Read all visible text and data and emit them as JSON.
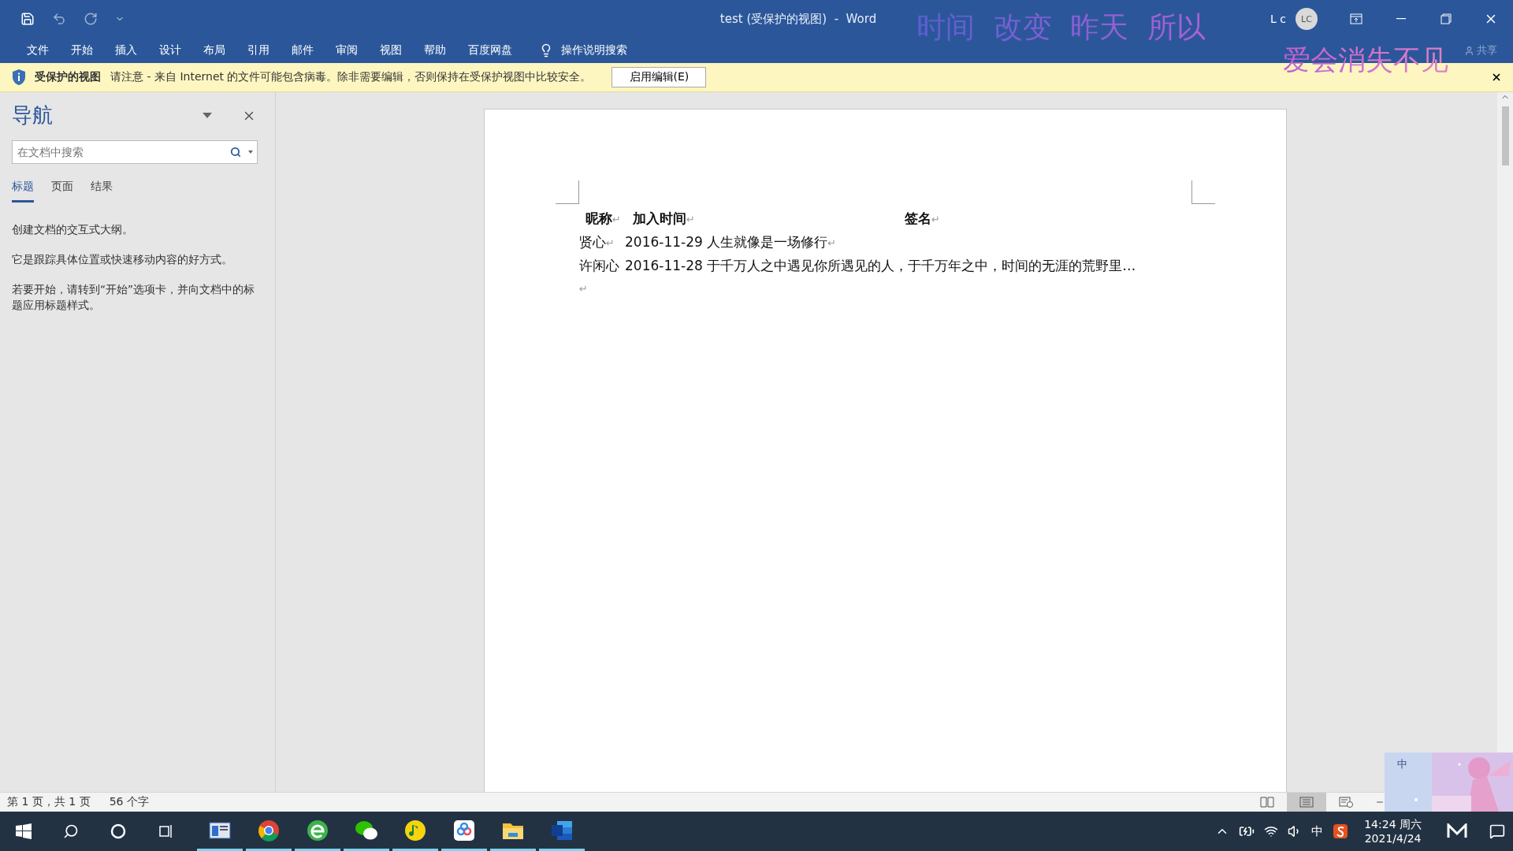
{
  "title_bar": {
    "title": "test (受保护的视图)  -  Word",
    "user": "L c",
    "avatar": "LC"
  },
  "lyrics": [
    "时间  改变  昨天  所以",
    "爱会消失不见"
  ],
  "ribbon": {
    "tabs": [
      "文件",
      "开始",
      "插入",
      "设计",
      "布局",
      "引用",
      "邮件",
      "审阅",
      "视图",
      "帮助",
      "百度网盘"
    ],
    "tell_me": "操作说明搜索",
    "share": "共享"
  },
  "protected_bar": {
    "title": "受保护的视图",
    "message": "请注意 - 来自 Internet 的文件可能包含病毒。除非需要编辑，否则保持在受保护视图中比较安全。",
    "button": "启用编辑(E)"
  },
  "navigation": {
    "title": "导航",
    "search": {
      "placeholder": "在文档中搜索"
    },
    "tabs": [
      {
        "label": "标题",
        "selected": true
      },
      {
        "label": "页面",
        "selected": false
      },
      {
        "label": "结果",
        "selected": false
      }
    ],
    "paragraphs": [
      "创建文档的交互式大纲。",
      "它是跟踪具体位置或快速移动内容的好方式。",
      "若要开始，请转到“开始”选项卡，并向文档中的标题应用标题样式。"
    ]
  },
  "document": {
    "pilcrow": "↵",
    "header": [
      {
        "text": "昵称",
        "mark": true
      },
      {
        "text": "加入时间",
        "mark": true
      },
      {
        "text": "签名",
        "mark": true
      }
    ],
    "rows": [
      {
        "name": {
          "text": "贤心",
          "mark": true
        },
        "entry": {
          "text": "2016-11-29 人生就像是一场修行",
          "mark": true
        }
      },
      {
        "name": {
          "text": "许闲心",
          "mark": false
        },
        "entry": {
          "text": "2016-11-28 于千万人之中遇见你所遇见的人，于千万年之中，时间的无涯的荒野里…",
          "mark": false
        }
      }
    ],
    "empty_paragraph": true
  },
  "status_bar": {
    "page": "第 1 页，共 1 页",
    "words": "56 个字",
    "views": [
      {
        "kind": "read",
        "selected": false
      },
      {
        "kind": "print",
        "selected": true
      },
      {
        "kind": "web",
        "selected": false
      }
    ]
  },
  "ime_widget": {
    "label": "中"
  },
  "taskbar": {
    "apps": [
      {
        "kind": "window",
        "running": true
      },
      {
        "kind": "round",
        "running": true
      },
      {
        "kind": "ebrowser",
        "running": true
      },
      {
        "kind": "chat",
        "running": true
      },
      {
        "kind": "music",
        "running": true
      },
      {
        "kind": "cloud",
        "running": true
      },
      {
        "kind": "folder",
        "running": true
      },
      {
        "kind": "word",
        "running": true
      }
    ],
    "ime": "中",
    "time": "14:24 周六",
    "date": "2021/4/24"
  }
}
